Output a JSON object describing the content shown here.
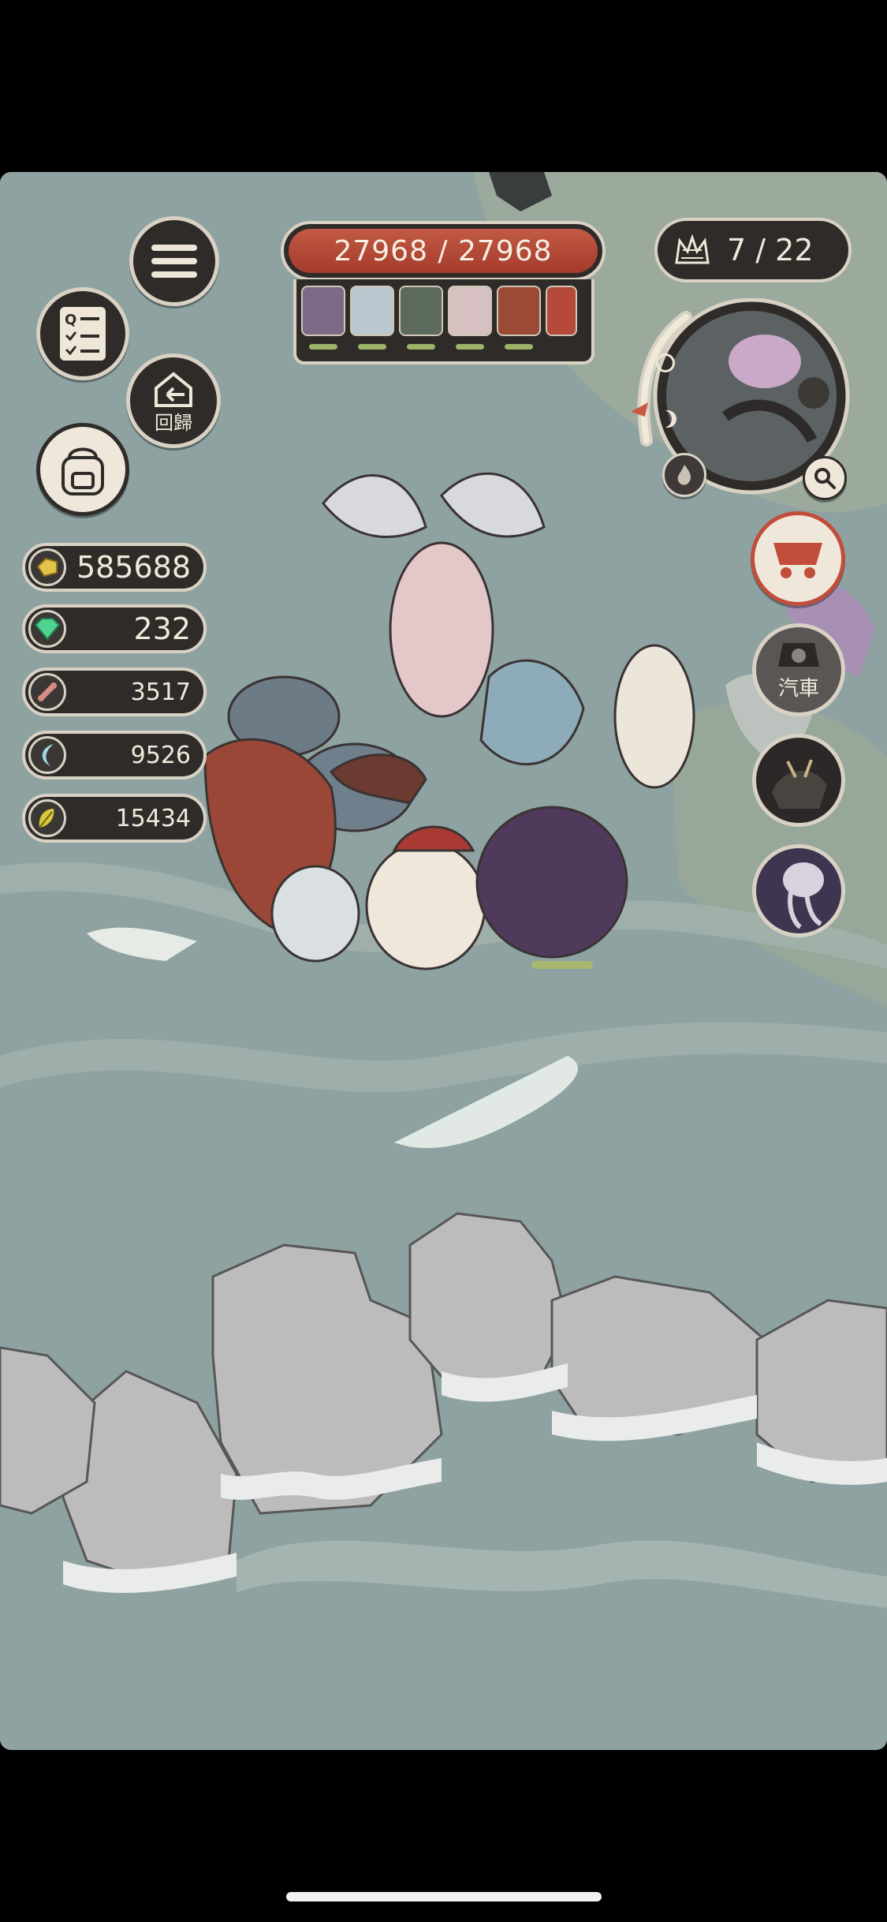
{
  "hud": {
    "hp_text": "27968 / 27968",
    "wave_text": "7 / 22"
  },
  "buttons": {
    "return_label": "回歸",
    "car_label": "汽車"
  },
  "resources": {
    "gold": "585688",
    "gems": "232",
    "bones": "3517",
    "claws": "9526",
    "feathers": "15434"
  },
  "party": [
    {
      "icon": "purple-beast-portrait",
      "color": "#7d6a86"
    },
    {
      "icon": "white-blue-beast-portrait",
      "color": "#b9c8cf"
    },
    {
      "icon": "green-beast-portrait",
      "color": "#5b6a5d"
    },
    {
      "icon": "pink-beast-portrait",
      "color": "#d7c0c1"
    },
    {
      "icon": "red-beast-portrait",
      "color": "#9a4a35"
    },
    {
      "icon": "active-skill-portrait",
      "color": "#b54a3a"
    }
  ],
  "colors": {
    "panel": "#2e2b29",
    "border": "#d9d2c4",
    "hp_red": "#b0432f",
    "sea": "#8fa3a2"
  }
}
